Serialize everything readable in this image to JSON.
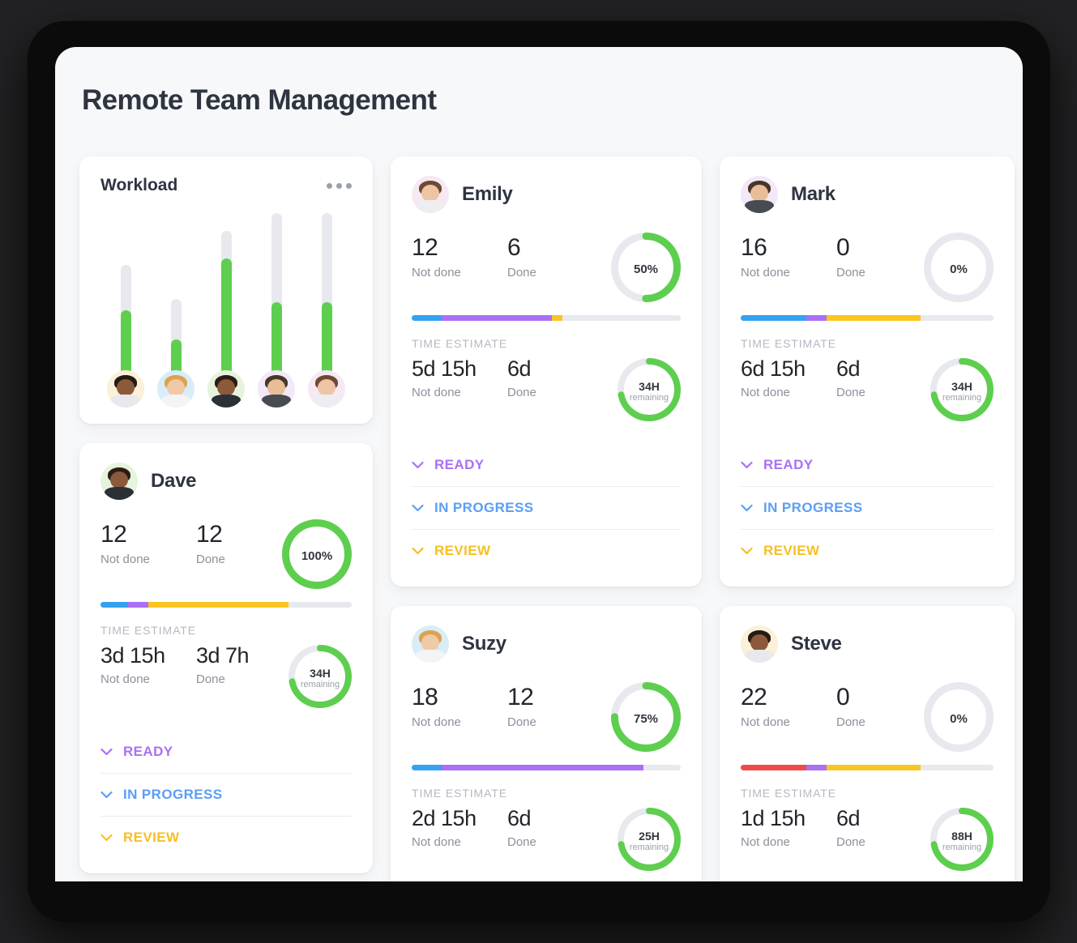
{
  "page": {
    "title": "Remote Team Management"
  },
  "colors": {
    "green": "#5ece4f",
    "track": "#e7e9ee",
    "blue": "#34a2f0",
    "purple": "#a970f5",
    "yellow": "#fbc521",
    "red": "#f04a4a",
    "ready": "#a970f5",
    "in_progress": "#5b9ef5",
    "review": "#f6bf26"
  },
  "workload": {
    "title": "Workload",
    "menu_icon": "more-options-icon",
    "chart_data": {
      "type": "bar",
      "title": "Workload",
      "categories": [
        "Steve",
        "Suzy",
        "Dave",
        "Mark",
        "Emily"
      ],
      "series": [
        {
          "name": "Filled",
          "values": [
            59,
            27,
            78,
            46,
            46
          ]
        },
        {
          "name": "Capacity",
          "values": [
            100,
            47,
            89,
            100,
            100
          ]
        }
      ],
      "ylim": [
        0,
        100
      ],
      "grid": false,
      "legend": "none"
    },
    "bars": [
      {
        "person": "Steve",
        "track_pct": 68,
        "fill_pct": 40
      },
      {
        "person": "Suzy",
        "track_pct": 47,
        "fill_pct": 22
      },
      {
        "person": "Dave",
        "track_pct": 89,
        "fill_pct": 72
      },
      {
        "person": "Mark",
        "track_pct": 100,
        "fill_pct": 45
      },
      {
        "person": "Emily",
        "track_pct": 100,
        "fill_pct": 45
      }
    ],
    "avatars": [
      {
        "name": "Steve",
        "bg": "#fbf0d8",
        "skin": "#8a5a3b",
        "hair": "#241a14",
        "body": "#e8e9ec"
      },
      {
        "name": "Suzy",
        "bg": "#d9edf8",
        "skin": "#f0c9a6",
        "hair": "#dda24e",
        "body": "#f3f4f6"
      },
      {
        "name": "Dave",
        "bg": "#e6f4dd",
        "skin": "#8a5a3b",
        "hair": "#2b1d15",
        "body": "#2b2f36"
      },
      {
        "name": "Mark",
        "bg": "#f3e8f8",
        "skin": "#e8bd98",
        "hair": "#4a3626",
        "body": "#474b52"
      },
      {
        "name": "Emily",
        "bg": "#f7e9f3",
        "skin": "#eec4a5",
        "hair": "#6d4a33",
        "body": "#eceef1"
      }
    ]
  },
  "status_rows": [
    {
      "label": "READY",
      "color": "#a970f5",
      "icon": "chevron-down-icon"
    },
    {
      "label": "IN PROGRESS",
      "color": "#5b9ef5",
      "icon": "chevron-down-icon"
    },
    {
      "label": "REVIEW",
      "color": "#f6bf26",
      "icon": "chevron-down-icon"
    }
  ],
  "labels": {
    "not_done": "Not done",
    "done": "Done",
    "time_estimate": "TIME ESTIMATE",
    "remaining": "remaining"
  },
  "members": [
    {
      "id": "dave",
      "name": "Dave",
      "avatar": {
        "bg": "#e6f4dd",
        "skin": "#8a5a3b",
        "hair": "#2b1d15",
        "body": "#2b2f36"
      },
      "tasks": {
        "not_done": "12",
        "done": "12",
        "percent": "100%",
        "percent_value": 100
      },
      "progress": [
        {
          "color": "#34a2f0",
          "pct": 11
        },
        {
          "color": "#a970f5",
          "pct": 8
        },
        {
          "color": "#fbc521",
          "pct": 56
        }
      ],
      "time": {
        "not_done": "3d 15h",
        "done": "3d 7h",
        "remaining": "34H",
        "percent_value": 72
      },
      "has_status": true
    },
    {
      "id": "emily",
      "name": "Emily",
      "avatar": {
        "bg": "#f7e9f3",
        "skin": "#eec4a5",
        "hair": "#6d4a33",
        "body": "#eceef1"
      },
      "tasks": {
        "not_done": "12",
        "done": "6",
        "percent": "50%",
        "percent_value": 50
      },
      "progress": [
        {
          "color": "#34a2f0",
          "pct": 11
        },
        {
          "color": "#a970f5",
          "pct": 41
        },
        {
          "color": "#fbc521",
          "pct": 4
        }
      ],
      "time": {
        "not_done": "5d 15h",
        "done": "6d",
        "remaining": "34H",
        "percent_value": 72
      },
      "has_status": true
    },
    {
      "id": "mark",
      "name": "Mark",
      "avatar": {
        "bg": "#f3e8f8",
        "skin": "#e8bd98",
        "hair": "#4a3626",
        "body": "#474b52"
      },
      "tasks": {
        "not_done": "16",
        "done": "0",
        "percent": "0%",
        "percent_value": 0
      },
      "progress": [
        {
          "color": "#34a2f0",
          "pct": 26
        },
        {
          "color": "#a970f5",
          "pct": 8
        },
        {
          "color": "#fbc521",
          "pct": 37
        }
      ],
      "time": {
        "not_done": "6d 15h",
        "done": "6d",
        "remaining": "34H",
        "percent_value": 72
      },
      "has_status": true
    },
    {
      "id": "suzy",
      "name": "Suzy",
      "avatar": {
        "bg": "#d9edf8",
        "skin": "#f0c9a6",
        "hair": "#dda24e",
        "body": "#f3f4f6"
      },
      "tasks": {
        "not_done": "18",
        "done": "12",
        "percent": "75%",
        "percent_value": 75
      },
      "progress": [
        {
          "color": "#34a2f0",
          "pct": 11
        },
        {
          "color": "#a970f5",
          "pct": 75
        }
      ],
      "time": {
        "not_done": "2d 15h",
        "done": "6d",
        "remaining": "25H",
        "percent_value": 72
      },
      "has_status": false
    },
    {
      "id": "steve",
      "name": "Steve",
      "avatar": {
        "bg": "#fbf0d8",
        "skin": "#8a5a3b",
        "hair": "#241a14",
        "body": "#e8e9ec"
      },
      "tasks": {
        "not_done": "22",
        "done": "0",
        "percent": "0%",
        "percent_value": 0
      },
      "progress": [
        {
          "color": "#f04a4a",
          "pct": 26
        },
        {
          "color": "#a970f5",
          "pct": 8
        },
        {
          "color": "#fbc521",
          "pct": 37
        }
      ],
      "time": {
        "not_done": "1d 15h",
        "done": "6d",
        "remaining": "88H",
        "percent_value": 72
      },
      "has_status": false
    }
  ]
}
